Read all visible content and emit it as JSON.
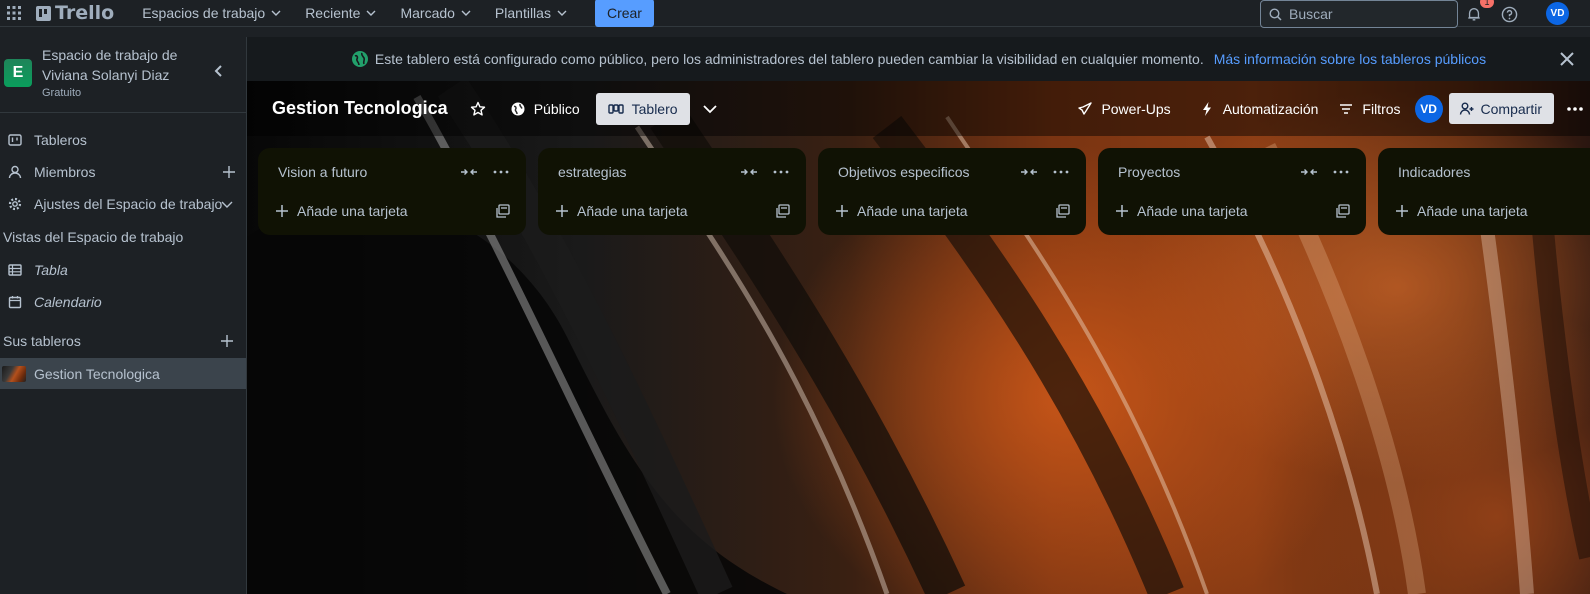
{
  "topnav": {
    "apps_icon": "apps-grid-icon",
    "logo_text": "Trello",
    "menu": [
      {
        "label": "Espacios de trabajo"
      },
      {
        "label": "Reciente"
      },
      {
        "label": "Marcado"
      },
      {
        "label": "Plantillas"
      }
    ],
    "create_label": "Crear",
    "search_placeholder": "Buscar",
    "notification_count": "1",
    "avatar_initials": "VD"
  },
  "sidebar": {
    "workspace_initial": "E",
    "workspace_name": "Espacio de trabajo de Viviana Solanyi Diaz",
    "workspace_plan": "Gratuito",
    "items": [
      {
        "label": "Tableros"
      },
      {
        "label": "Miembros"
      },
      {
        "label": "Ajustes del Espacio de trabajo"
      }
    ],
    "views_heading": "Vistas del Espacio de trabajo",
    "views": [
      {
        "label": "Tabla"
      },
      {
        "label": "Calendario"
      }
    ],
    "boards_heading": "Sus tableros",
    "boards": [
      {
        "label": "Gestion Tecnologica"
      }
    ]
  },
  "banner": {
    "text": "Este tablero está configurado como público, pero los administradores del tablero pueden cambiar la visibilidad en cualquier momento.",
    "link": "Más información sobre los tableros públicos"
  },
  "boardbar": {
    "title": "Gestion Tecnologica",
    "visibility": "Público",
    "view": "Tablero",
    "powerups": "Power-Ups",
    "automation": "Automatización",
    "filters": "Filtros",
    "member_initials": "VD",
    "share": "Compartir"
  },
  "lists": [
    {
      "title": "Vision a futuro",
      "add_card": "Añade una tarjeta"
    },
    {
      "title": "estrategias",
      "add_card": "Añade una tarjeta"
    },
    {
      "title": "Objetivos especificos",
      "add_card": "Añade una tarjeta"
    },
    {
      "title": "Proyectos",
      "add_card": "Añade una tarjeta"
    },
    {
      "title": "Indicadores",
      "add_card": "Añade una tarjeta"
    }
  ],
  "colors": {
    "accent": "#579dff",
    "nav_bg": "#1d2125",
    "list_bg": "#101204",
    "workspace_green": "#1f845a",
    "avatar_blue": "#0c66e4"
  }
}
